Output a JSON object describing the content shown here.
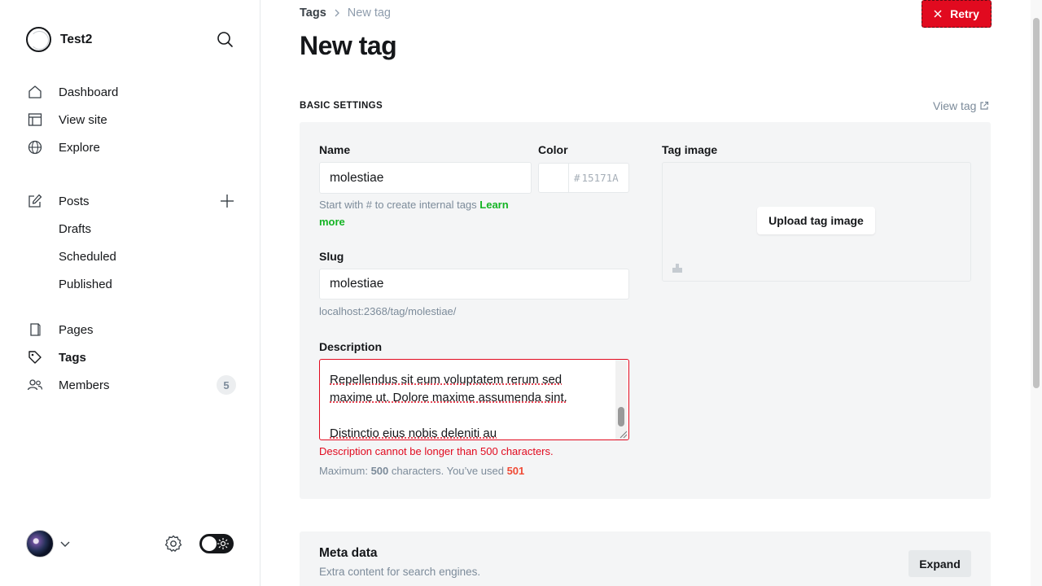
{
  "sidebar": {
    "site_name": "Test2",
    "nav": [
      {
        "label": "Dashboard",
        "icon": "house-icon"
      },
      {
        "label": "View site",
        "icon": "layout-icon"
      },
      {
        "label": "Explore",
        "icon": "globe-icon"
      },
      {
        "label": "Posts",
        "icon": "edit-icon"
      },
      {
        "label": "Drafts"
      },
      {
        "label": "Scheduled"
      },
      {
        "label": "Published"
      },
      {
        "label": "Pages",
        "icon": "page-icon"
      },
      {
        "label": "Tags",
        "icon": "tag-icon"
      },
      {
        "label": "Members",
        "icon": "members-icon"
      }
    ],
    "members_count": "5"
  },
  "header": {
    "breadcrumb_root": "Tags",
    "breadcrumb_current": "New tag",
    "title": "New tag",
    "retry_label": "Retry"
  },
  "basic": {
    "section_label": "BASIC SETTINGS",
    "view_tag_label": "View tag",
    "name_label": "Name",
    "name_value": "molestiae",
    "color_label": "Color",
    "color_hash": "#",
    "color_placeholder": "15171A",
    "name_hint": "Start with # to create internal tags",
    "name_hint_link": "Learn more",
    "slug_label": "Slug",
    "slug_value": "molestiae",
    "slug_url": "localhost:2368/tag/molestiae/",
    "description_label": "Description",
    "description_lines": [
      "Repellendus sit eum voluptatem rerum sed",
      "maxime ut. Dolore maxime assumenda sint.",
      "",
      "Distinctio eius nobis deleniti au"
    ],
    "error": "Description cannot be longer than 500 characters.",
    "max_prefix": "Maximum:",
    "max_limit": "500",
    "max_middle": "characters. You’ve used",
    "max_used": "501",
    "tag_image_label": "Tag image",
    "upload_label": "Upload tag image"
  },
  "meta": {
    "title": "Meta data",
    "subtitle": "Extra content for search engines.",
    "expand_label": "Expand"
  },
  "colors": {
    "accent_green": "#14b424",
    "error_red": "#e10a1f",
    "panel_bg": "#f4f5f6"
  }
}
